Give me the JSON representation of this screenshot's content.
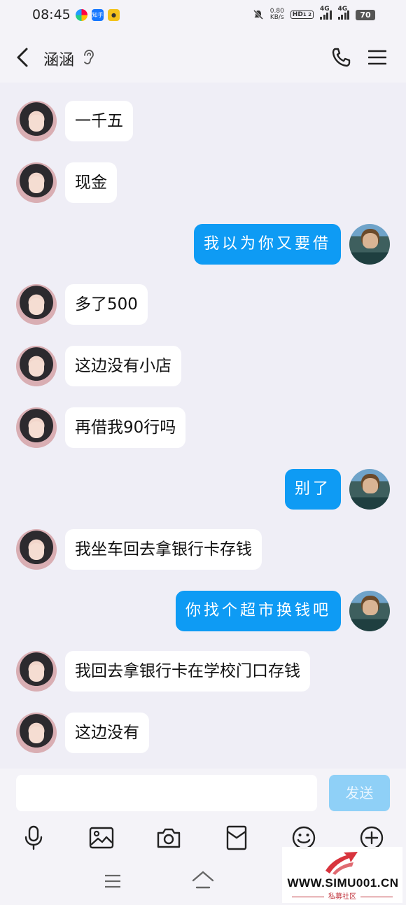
{
  "status_bar": {
    "time": "08:45",
    "app_icons": [
      "chrome-like-icon",
      "zhihu-icon",
      "qq-icon"
    ],
    "zhihu_label": "知乎",
    "network_speed_value": "0.80",
    "network_speed_unit": "KB/s",
    "hd_label": "HD",
    "hd_sub": "1 2",
    "signal1_label": "4G",
    "signal2_label": "4G",
    "battery": "70"
  },
  "header": {
    "title": "涵涵"
  },
  "messages": [
    {
      "side": "in",
      "text": "一千五"
    },
    {
      "side": "in",
      "text": "现金"
    },
    {
      "side": "out",
      "text": "我以为你又要借"
    },
    {
      "side": "in",
      "text": "多了500"
    },
    {
      "side": "in",
      "text": "这边没有小店"
    },
    {
      "side": "in",
      "text": "再借我90行吗"
    },
    {
      "side": "out",
      "text": "别了"
    },
    {
      "side": "in",
      "text": "我坐车回去拿银行卡存钱"
    },
    {
      "side": "out",
      "text": "你找个超市换钱吧"
    },
    {
      "side": "in",
      "text": "我回去拿银行卡在学校门口存钱"
    },
    {
      "side": "in",
      "text": "这边没有"
    }
  ],
  "input": {
    "placeholder": "",
    "send_label": "发送"
  },
  "toolbar": [
    "mic-icon",
    "image-icon",
    "camera-icon",
    "red-packet-icon",
    "emoji-icon",
    "plus-icon"
  ],
  "watermark": {
    "url": "WWW.SIMU001.CN",
    "subtitle": "私募社区"
  },
  "colors": {
    "accent": "#0e9bf4",
    "background": "#efeef6",
    "send_disabled": "#8fd0f7"
  }
}
